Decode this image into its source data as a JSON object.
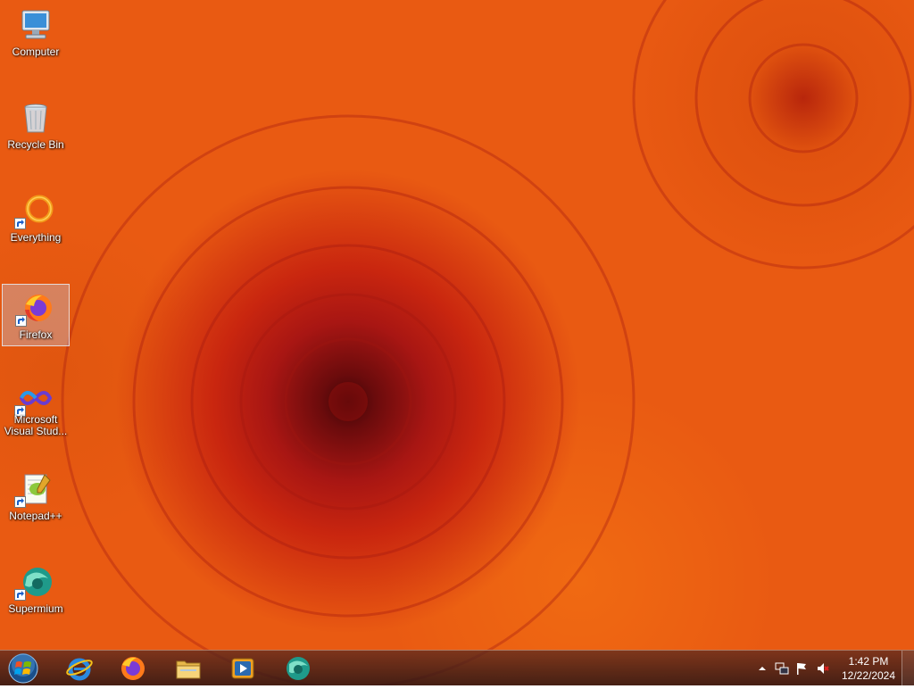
{
  "desktop": {
    "icons": [
      {
        "label": "Computer",
        "icon": "computer-icon",
        "shortcut": false,
        "selected": false
      },
      {
        "label": "Recycle Bin",
        "icon": "recycle-bin-icon",
        "shortcut": false,
        "selected": false
      },
      {
        "label": "Everything",
        "icon": "everything-icon",
        "shortcut": true,
        "selected": false
      },
      {
        "label": "Firefox",
        "icon": "firefox-icon",
        "shortcut": true,
        "selected": true
      },
      {
        "label": "Microsoft Visual Stud...",
        "icon": "visual-studio-icon",
        "shortcut": true,
        "selected": false
      },
      {
        "label": "Notepad++",
        "icon": "notepad-plus-plus-icon",
        "shortcut": true,
        "selected": false
      },
      {
        "label": "Supermium",
        "icon": "supermium-icon",
        "shortcut": true,
        "selected": false
      }
    ]
  },
  "taskbar": {
    "start_icon": "windows-orb-icon",
    "pinned": [
      {
        "icon": "internet-explorer-icon"
      },
      {
        "icon": "firefox-icon"
      },
      {
        "icon": "file-explorer-icon"
      },
      {
        "icon": "media-player-icon"
      },
      {
        "icon": "supermium-icon"
      }
    ],
    "tray": {
      "icons": [
        "show-hidden-icons-icon",
        "network-icon",
        "action-center-flag-icon",
        "volume-muted-icon"
      ],
      "time": "1:42 PM",
      "date": "12/22/2024"
    }
  },
  "colors": {
    "taskbar": "#3a1c18",
    "selection": "#bed2f0",
    "wallpaper": "#e95a12"
  }
}
